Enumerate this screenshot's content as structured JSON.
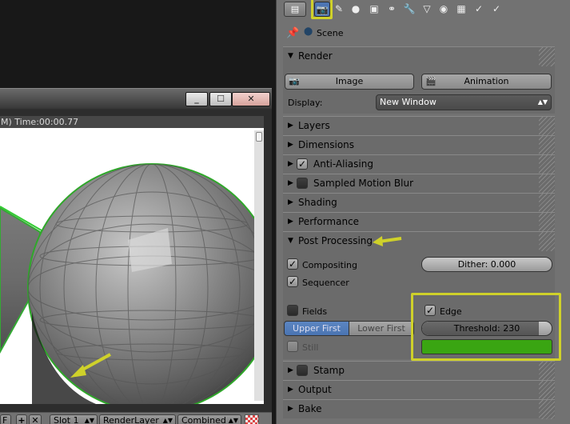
{
  "render_window": {
    "info_text": "M) Time:00:00.77",
    "buttons": {
      "minimize": "_",
      "maximize": "☐",
      "close": "✕"
    },
    "footer": {
      "f_label": "F",
      "slot": "Slot 1",
      "render_layer": "RenderLayer",
      "pass": "Combined",
      "plus": "+",
      "x": "✕"
    }
  },
  "properties": {
    "header": {
      "editor_icon": "▤",
      "tabs": [
        "render-icon",
        "render-layers-icon",
        "world-icon",
        "object-icon",
        "constraints-icon",
        "modifiers-icon",
        "data-icon",
        "material-icon",
        "texture-icon",
        "physics-icon"
      ],
      "highlight_color": "#cfd12a",
      "tab_glyphs": [
        "📷",
        "✎",
        "●",
        "▣",
        "⚭",
        "🔧",
        "▽",
        "◉",
        "▦",
        "✓"
      ]
    },
    "context": {
      "pin_icon": "pin-icon",
      "scene_label": "Scene"
    },
    "render_panel": {
      "title": "Render",
      "image_button": "Image",
      "animation_button": "Animation",
      "display_label": "Display:",
      "display_value": "New Window"
    },
    "panels": {
      "layers": "Layers",
      "dimensions": "Dimensions",
      "anti_aliasing": "Anti-Aliasing",
      "motion_blur": "Sampled Motion Blur",
      "shading": "Shading",
      "performance": "Performance",
      "post_processing": "Post Processing",
      "stamp": "Stamp",
      "output": "Output",
      "bake": "Bake"
    },
    "post_processing": {
      "compositing": "Compositing",
      "sequencer": "Sequencer",
      "dither": "Dither: 0.000",
      "fields": "Fields",
      "upper_first": "Upper First",
      "lower_first": "Lower First",
      "still": "Still",
      "edge": "Edge",
      "threshold": "Threshold: 230",
      "threshold_value": 230,
      "threshold_max": 255,
      "edge_color": "#3aa512"
    }
  }
}
